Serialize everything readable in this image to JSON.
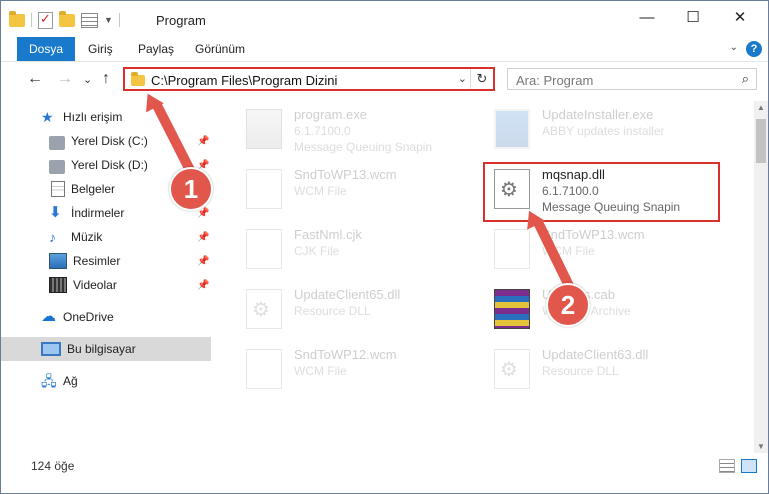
{
  "window": {
    "title": "Program",
    "minimize_glyph": "—",
    "maximize_glyph": "☐",
    "close_glyph": "✕"
  },
  "ribbon": {
    "tabs": [
      {
        "label": "Dosya",
        "active": true
      },
      {
        "label": "Giriş",
        "active": false
      },
      {
        "label": "Paylaş",
        "active": false
      },
      {
        "label": "Görünüm",
        "active": false
      }
    ],
    "help_glyph": "?"
  },
  "nav": {
    "back_glyph": "←",
    "forward_glyph": "→",
    "recent_glyph": "⌄",
    "up_glyph": "↑",
    "address": "C:\\Program Files\\Program Dizini",
    "refresh_glyph": "↻",
    "search_placeholder": "Ara: Program"
  },
  "sidebar": {
    "items": [
      {
        "label": "Hızlı erişim",
        "icon": "star-icon",
        "pinned": false
      },
      {
        "label": "Yerel Disk (C:)",
        "icon": "disk-icon",
        "pinned": true
      },
      {
        "label": "Yerel Disk (D:)",
        "icon": "disk-icon",
        "pinned": true
      },
      {
        "label": "Belgeler",
        "icon": "document-icon",
        "pinned": true
      },
      {
        "label": "İndirmeler",
        "icon": "download-icon",
        "pinned": true
      },
      {
        "label": "Müzik",
        "icon": "music-icon",
        "pinned": true
      },
      {
        "label": "Resimler",
        "icon": "pictures-icon",
        "pinned": true
      },
      {
        "label": "Videolar",
        "icon": "videos-icon",
        "pinned": true
      },
      {
        "label": "OneDrive",
        "icon": "cloud-icon",
        "pinned": false
      },
      {
        "label": "Bu bilgisayar",
        "icon": "computer-icon",
        "pinned": false,
        "selected": true
      },
      {
        "label": "Ağ",
        "icon": "network-icon",
        "pinned": false
      }
    ],
    "pin_glyph": "📌"
  },
  "files": [
    {
      "name": "program.exe",
      "line1": "6.1.7100.0",
      "line2": "Message Queuing Snapin",
      "icon": "exe-icon",
      "faded": true
    },
    {
      "name": "UpdateInstaller.exe",
      "line1": "ABBY updates installer",
      "line2": "",
      "icon": "window-icon",
      "faded": true
    },
    {
      "name": "SndToWP13.wcm",
      "line1": "WCM File",
      "line2": "",
      "icon": "file-icon",
      "faded": true
    },
    {
      "name": "mqsnap.dll",
      "line1": "6.1.7100.0",
      "line2": "Message Queuing Snapin",
      "icon": "gear-file-icon",
      "faded": false
    },
    {
      "name": "FastNml.cjk",
      "line1": "CJK File",
      "line2": "",
      "icon": "file-icon",
      "faded": true
    },
    {
      "name": "SndToWP13.wcm",
      "line1": "WCM File",
      "line2": "",
      "icon": "file-icon",
      "faded": true
    },
    {
      "name": "UpdateClient65.dll",
      "line1": "Resource DLL",
      "line2": "",
      "icon": "gear-file-icon",
      "faded": true
    },
    {
      "name": "Updates.cab",
      "line1": "WinRAR Archive",
      "line2": "",
      "icon": "archive-icon",
      "faded": true
    },
    {
      "name": "SndToWP12.wcm",
      "line1": "WCM File",
      "line2": "",
      "icon": "file-icon",
      "faded": true
    },
    {
      "name": "UpdateClient63.dll",
      "line1": "Resource DLL",
      "line2": "",
      "icon": "gear-file-icon",
      "faded": true
    }
  ],
  "status": {
    "count": "124 öğe"
  },
  "annotations": {
    "step1": "1",
    "step2": "2",
    "color": "#e2574c"
  }
}
